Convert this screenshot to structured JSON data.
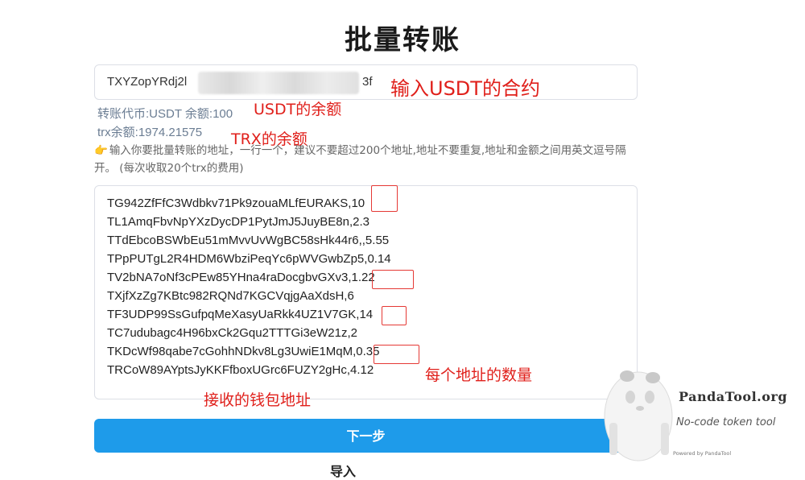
{
  "page": {
    "title": "批量转账"
  },
  "contract": {
    "value_prefix": "TXYZopYRdj2l",
    "value_suffix": "3f"
  },
  "info": {
    "token_line": "转账代币:USDT 余额:100",
    "trx_line": "trx余额:1974.21575"
  },
  "hint": {
    "text": "输入你要批量转账的地址，一行一个，建议不要超过200个地址,地址不要重复,地址和金额之间用英文逗号隔开。 (每次收取20个trx的费用)"
  },
  "addresses": [
    "TG942ZfFfC3Wdbkv71Pk9zouaMLfEURAKS,10",
    "TL1AmqFbvNpYXzDycDP1PytJmJ5JuyBE8n,2.3",
    "TTdEbcoBSWbEu51mMvvUvWgBC58sHk44r6,,5.55",
    "TPpPUTgL2R4HDM6WbziPeqYc6pWVGwbZp5,0.14",
    "TV2bNA7oNf3cPEw85YHna4raDocgbvGXv3,1.22",
    "TXjfXzZg7KBtc982RQNd7KGCVqjgAaXdsH,6",
    "TF3UDP99SsGufpqMeXasyUaRkk4UZ1V7GK,14",
    "TC7udubagc4H96bxCk2Gqu2TTTGi3eW21z,2",
    "TKDcWf98qabe7cGohhNDkv8Lg3UwiE1MqM,0.35",
    "TRCoW89AYptsJyKKFfboxUGrc6FUZY2gHc,4.12"
  ],
  "annotations": {
    "contract": "输入USDT的合约",
    "usdt_balance": "USDT的余额",
    "trx_balance": "TRX的余额",
    "amount": "每个地址的数量",
    "receiver": "接收的钱包地址"
  },
  "actions": {
    "next_label": "下一步",
    "below_text": "导入"
  },
  "watermark": {
    "brand": "PandaTool.org",
    "tagline": "No-code token tool",
    "powered": "Powered by PandaTool"
  },
  "colors": {
    "accent": "#1e9bea",
    "annotation": "#e0201b",
    "info": "#6b7d93"
  }
}
